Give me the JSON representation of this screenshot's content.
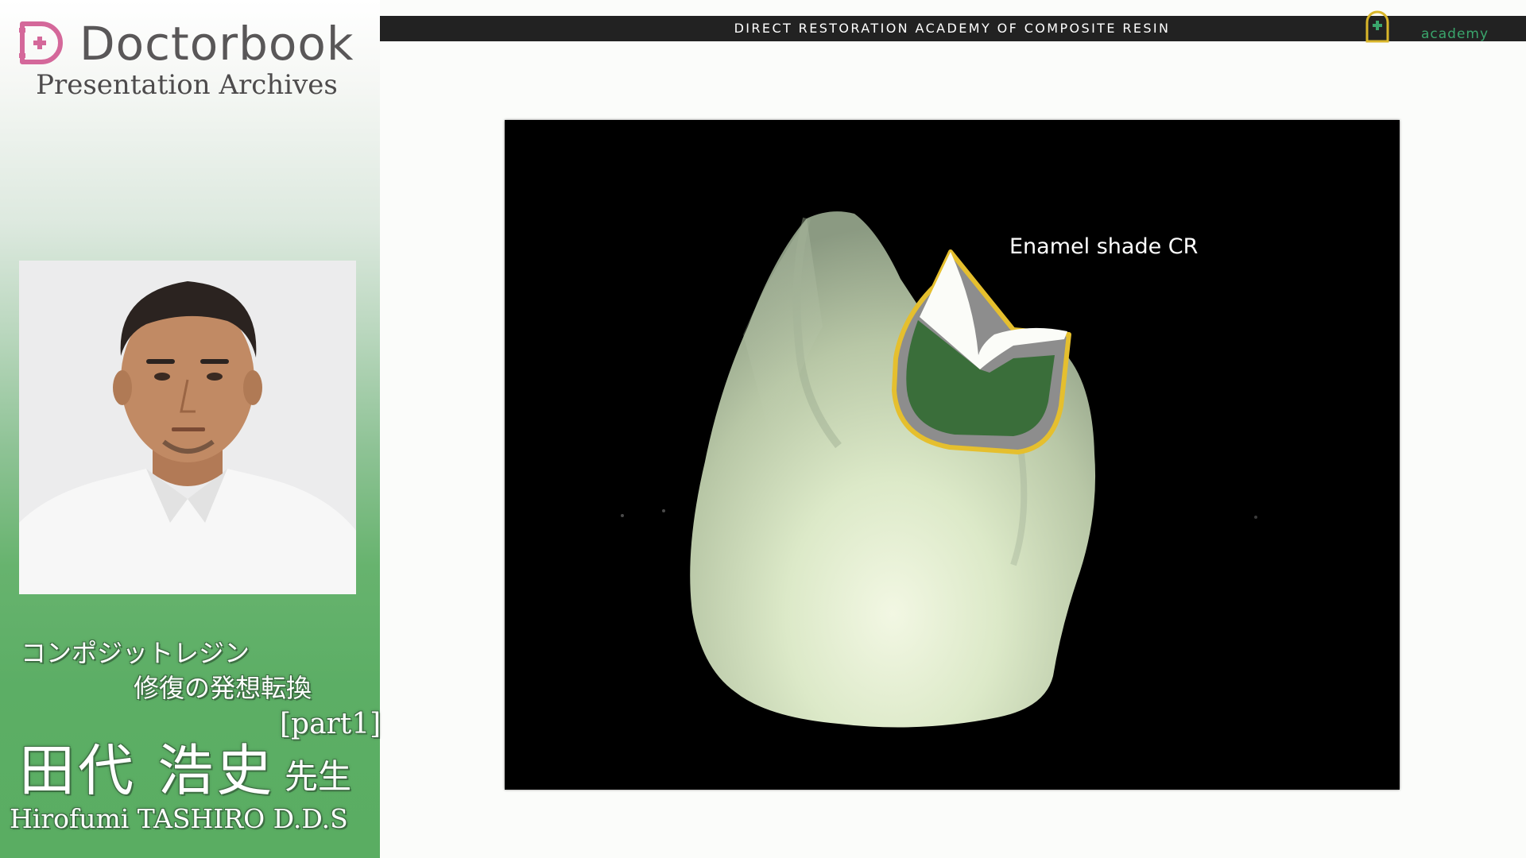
{
  "sidebar": {
    "brand_name": "Doctorbook",
    "brand_subtitle": "Presentation Archives",
    "series_title_line1": "コンポジットレジン",
    "series_title_line2": "修復の発想転換",
    "part_label": "[part1]",
    "speaker_name_jp": "田代 浩史",
    "speaker_honorific": "先生",
    "speaker_name_en": "Hirofumi TASHIRO D.D.S"
  },
  "header": {
    "bar_title": "DIRECT RESTORATION ACADEMY OF COMPOSITE RESIN",
    "academy_label": "academy"
  },
  "slide": {
    "annotation": "Enamel shade CR"
  },
  "colors": {
    "panel_green": "#5aad62",
    "brand_pink": "#d4689a",
    "top_bar": "#222222",
    "academy_green": "#3aa56c",
    "outline_yellow": "#e5bf2e",
    "cavity_green": "#3a6e3a"
  },
  "icons": {
    "brand": "doctorbook-d-logo-icon",
    "academy": "academy-shield-icon"
  }
}
